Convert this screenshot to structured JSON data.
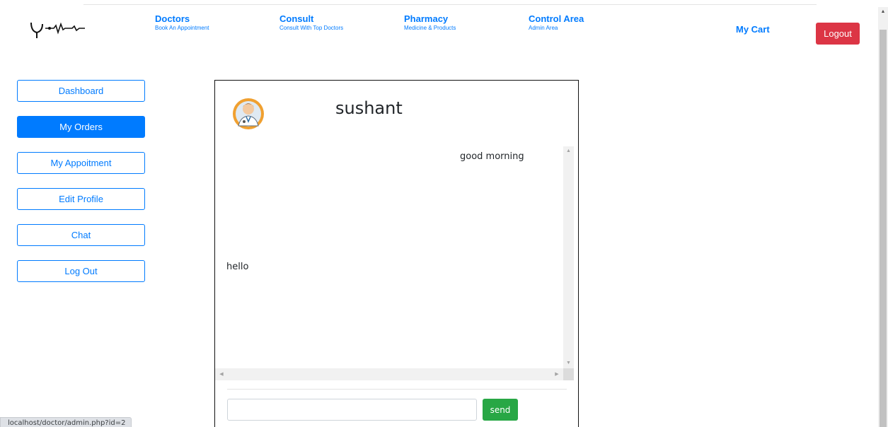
{
  "nav": {
    "logo_icon": "stethoscope-heartbeat-icon",
    "items": [
      {
        "title": "Doctors",
        "subtitle": "Book An Appointment"
      },
      {
        "title": "Consult",
        "subtitle": "Consult With Top Doctors"
      },
      {
        "title": "Pharmacy",
        "subtitle": "Medicine & Products"
      },
      {
        "title": "Control Area",
        "subtitle": "Admin Area"
      }
    ],
    "cart_label": "My Cart",
    "logout_label": "Logout"
  },
  "sidebar": {
    "items": [
      {
        "label": "Dashboard",
        "active": false
      },
      {
        "label": "My Orders",
        "active": true
      },
      {
        "label": "My Appoitment",
        "active": false
      },
      {
        "label": "Edit Profile",
        "active": false
      },
      {
        "label": "Chat",
        "active": false
      },
      {
        "label": "Log Out",
        "active": false
      }
    ]
  },
  "chat": {
    "avatar_icon": "doctor-avatar-icon",
    "contact_name": "sushant",
    "messages": [
      {
        "text": "good morning",
        "side": "right"
      },
      {
        "text": "hello",
        "side": "left"
      }
    ],
    "input_value": "",
    "input_placeholder": "",
    "send_label": "send"
  },
  "status_bar": {
    "url": "localhost/doctor/admin.php?id=2"
  },
  "colors": {
    "primary": "#007bff",
    "danger": "#dc3545",
    "success": "#28a745"
  }
}
